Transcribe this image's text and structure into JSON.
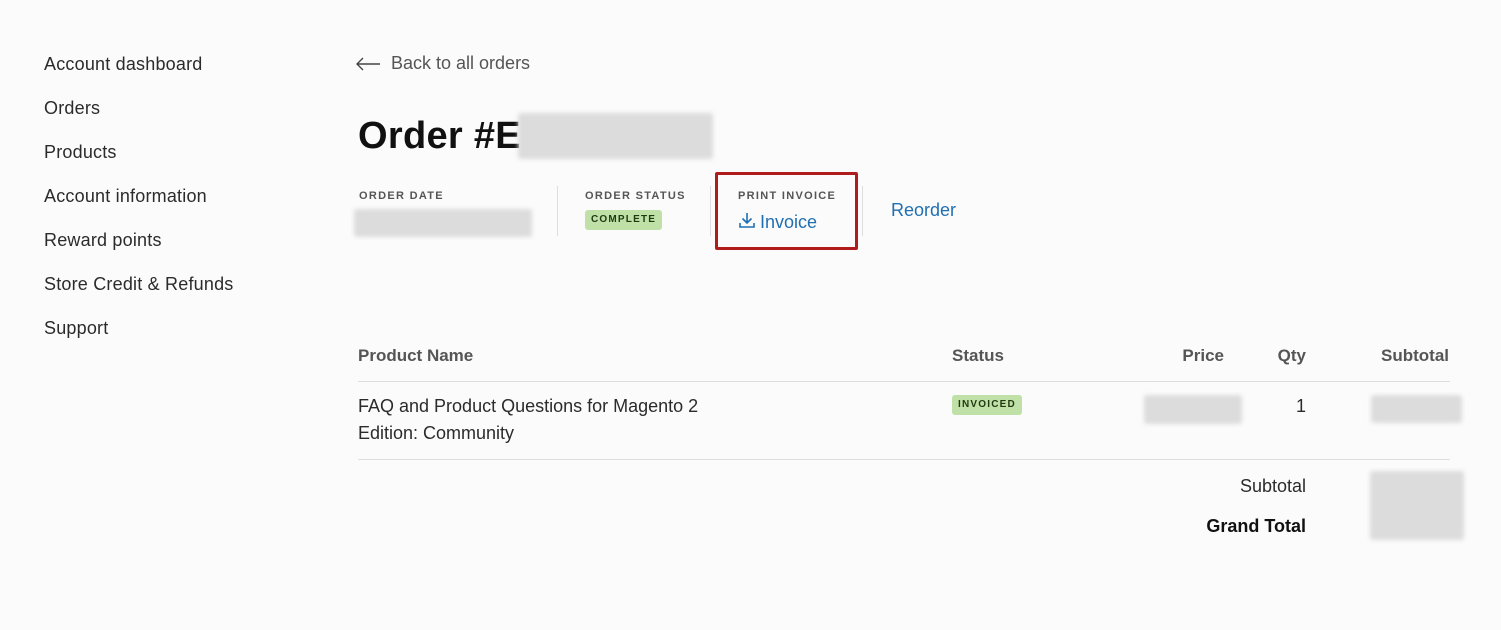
{
  "sidebar": {
    "items": [
      {
        "label": "Account dashboard"
      },
      {
        "label": "Orders"
      },
      {
        "label": "Products"
      },
      {
        "label": "Account information"
      },
      {
        "label": "Reward points"
      },
      {
        "label": "Store Credit & Refunds"
      },
      {
        "label": "Support"
      }
    ]
  },
  "back_link": {
    "label": "Back to all orders",
    "icon": "arrow-left-icon"
  },
  "order": {
    "title_prefix": "Order #E",
    "meta": {
      "date_label": "ORDER DATE",
      "status_label": "ORDER STATUS",
      "status_value": "COMPLETE",
      "print_label": "PRINT INVOICE",
      "invoice_link": "Invoice",
      "invoice_icon": "download-icon",
      "reorder_link": "Reorder"
    }
  },
  "table": {
    "headers": {
      "product": "Product Name",
      "status": "Status",
      "price": "Price",
      "qty": "Qty",
      "subtotal": "Subtotal"
    },
    "rows": [
      {
        "name": "FAQ and Product Questions for Magento 2",
        "edition": "Edition: Community",
        "status": "INVOICED",
        "qty": "1"
      }
    ]
  },
  "totals": {
    "subtotal_label": "Subtotal",
    "grand_total_label": "Grand Total"
  },
  "colors": {
    "link": "#1f6fb2",
    "badge_bg": "#bfe0a6",
    "highlight_border": "#b01c1c"
  }
}
